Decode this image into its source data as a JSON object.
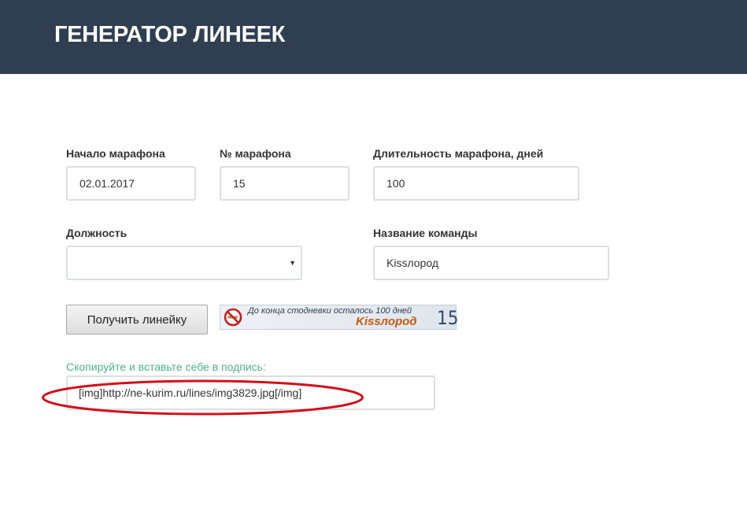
{
  "header": {
    "title": "ГЕНЕРАТОР ЛИНЕЕК"
  },
  "form": {
    "start_label": "Начало марафона",
    "start_value": "02.01.2017",
    "number_label": "№ марафона",
    "number_value": "15",
    "duration_label": "Длительность марафона, дней",
    "duration_value": "100",
    "position_label": "Должность",
    "position_value": "",
    "team_label": "Название команды",
    "team_value": "Kissлород",
    "submit_label": "Получить линейку"
  },
  "ruler": {
    "text": "До конца стодневки осталось 100 дней",
    "team": "Kissлород",
    "number": "15",
    "icon": "no-sign-icon"
  },
  "output": {
    "label": "Скопируйте и вставьте себе в подпись:",
    "code": "[img]http://ne-kurim.ru/lines/img3829.jpg[/img]"
  },
  "colors": {
    "header_bg": "#2f3e50",
    "copy_label": "#4fb38a",
    "highlight_ellipse": "#d0101b"
  }
}
